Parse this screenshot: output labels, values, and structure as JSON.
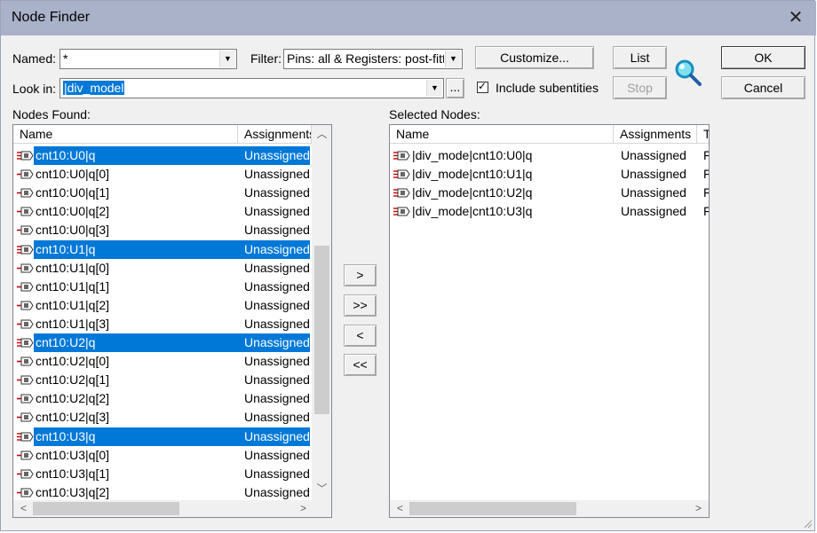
{
  "window": {
    "title": "Node Finder"
  },
  "controls": {
    "named_label": "Named:",
    "named_value": "*",
    "filter_label": "Filter:",
    "filter_value": "Pins: all & Registers: post-fittir",
    "lookin_label": "Look in:",
    "lookin_value": "|div_model",
    "browse_label": "...",
    "include_subentities_label": "Include subentities",
    "include_subentities_checked": true,
    "customize_label": "Customize...",
    "list_label": "List",
    "stop_label": "Stop",
    "ok_label": "OK",
    "cancel_label": "Cancel"
  },
  "nodes_found": {
    "label": "Nodes Found:",
    "columns": [
      "Name",
      "Assignments"
    ],
    "rows": [
      {
        "name": "cnt10:U0|q",
        "assignment": "Unassigned",
        "selected": true,
        "icon": "bus-pin-icon"
      },
      {
        "name": "cnt10:U0|q[0]",
        "assignment": "Unassigned",
        "selected": false,
        "icon": "register-pin-icon"
      },
      {
        "name": "cnt10:U0|q[1]",
        "assignment": "Unassigned",
        "selected": false,
        "icon": "register-pin-icon"
      },
      {
        "name": "cnt10:U0|q[2]",
        "assignment": "Unassigned",
        "selected": false,
        "icon": "register-pin-icon"
      },
      {
        "name": "cnt10:U0|q[3]",
        "assignment": "Unassigned",
        "selected": false,
        "icon": "register-pin-icon"
      },
      {
        "name": "cnt10:U1|q",
        "assignment": "Unassigned",
        "selected": true,
        "icon": "bus-pin-icon"
      },
      {
        "name": "cnt10:U1|q[0]",
        "assignment": "Unassigned",
        "selected": false,
        "icon": "register-pin-icon"
      },
      {
        "name": "cnt10:U1|q[1]",
        "assignment": "Unassigned",
        "selected": false,
        "icon": "register-pin-icon"
      },
      {
        "name": "cnt10:U1|q[2]",
        "assignment": "Unassigned",
        "selected": false,
        "icon": "register-pin-icon"
      },
      {
        "name": "cnt10:U1|q[3]",
        "assignment": "Unassigned",
        "selected": false,
        "icon": "register-pin-icon"
      },
      {
        "name": "cnt10:U2|q",
        "assignment": "Unassigned",
        "selected": true,
        "icon": "bus-pin-icon"
      },
      {
        "name": "cnt10:U2|q[0]",
        "assignment": "Unassigned",
        "selected": false,
        "icon": "register-pin-icon"
      },
      {
        "name": "cnt10:U2|q[1]",
        "assignment": "Unassigned",
        "selected": false,
        "icon": "register-pin-icon"
      },
      {
        "name": "cnt10:U2|q[2]",
        "assignment": "Unassigned",
        "selected": false,
        "icon": "register-pin-icon"
      },
      {
        "name": "cnt10:U2|q[3]",
        "assignment": "Unassigned",
        "selected": false,
        "icon": "register-pin-icon"
      },
      {
        "name": "cnt10:U3|q",
        "assignment": "Unassigned",
        "selected": true,
        "icon": "bus-pin-icon"
      },
      {
        "name": "cnt10:U3|q[0]",
        "assignment": "Unassigned",
        "selected": false,
        "icon": "register-pin-icon"
      },
      {
        "name": "cnt10:U3|q[1]",
        "assignment": "Unassigned",
        "selected": false,
        "icon": "register-pin-icon"
      },
      {
        "name": "cnt10:U3|q[2]",
        "assignment": "Unassigned",
        "selected": false,
        "icon": "register-pin-icon"
      }
    ]
  },
  "transfer_buttons": {
    "add": ">",
    "add_all": ">>",
    "remove": "<",
    "remove_all": "<<"
  },
  "selected_nodes": {
    "label": "Selected Nodes:",
    "columns": [
      "Name",
      "Assignments",
      "T"
    ],
    "rows": [
      {
        "name": "|div_mode|cnt10:U0|q",
        "assignment": "Unassigned",
        "extra": "F"
      },
      {
        "name": "|div_mode|cnt10:U1|q",
        "assignment": "Unassigned",
        "extra": "F"
      },
      {
        "name": "|div_mode|cnt10:U2|q",
        "assignment": "Unassigned",
        "extra": "F"
      },
      {
        "name": "|div_mode|cnt10:U3|q",
        "assignment": "Unassigned",
        "extra": "F"
      }
    ]
  },
  "colors": {
    "selection": "#0078d7",
    "titlebar": "#aab2c9"
  }
}
